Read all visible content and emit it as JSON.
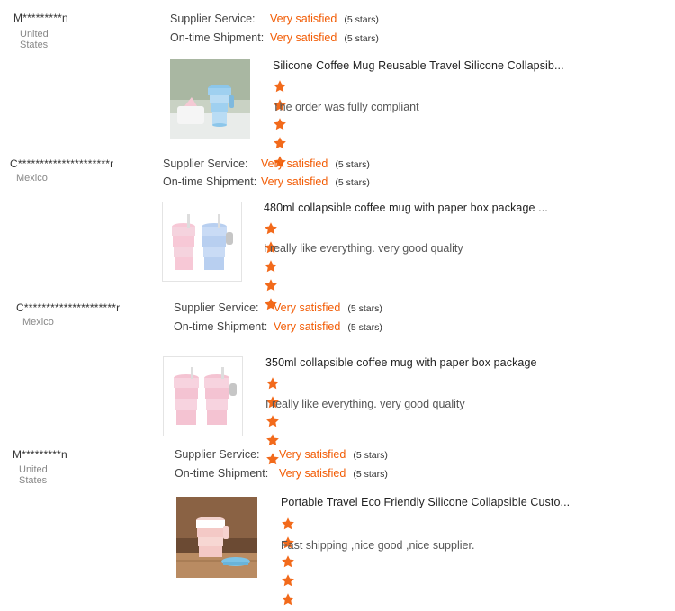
{
  "reviews": [
    {
      "buyer": "M*********n",
      "country": "United States",
      "supplier_label": "Supplier Service:",
      "supplier_value": "Very satisfied",
      "supplier_stars": "(5 stars)",
      "shipment_label": "On-time Shipment:",
      "shipment_value": "Very satisfied",
      "shipment_stars": "(5 stars)",
      "product_title": "Silicone Coffee Mug Reusable Travel Silicone Collapsib...",
      "rating": 5,
      "comment": "The order was fully compliant",
      "thumb_icon": "green-collapsible-mug-photo"
    },
    {
      "buyer": "C*********************r",
      "country": "Mexico",
      "supplier_label": "Supplier Service:",
      "supplier_value": "Very satisfied",
      "supplier_stars": "(5 stars)",
      "shipment_label": "On-time Shipment:",
      "shipment_value": "Very satisfied",
      "shipment_stars": "(5 stars)",
      "product_title": "480ml collapsible coffee mug with paper box package ...",
      "rating": 5,
      "comment": "I really like everything. very good quality",
      "thumb_icon": "pink-blue-mugs-photo"
    },
    {
      "buyer": "C*********************r",
      "country": "Mexico",
      "supplier_label": "Supplier Service:",
      "supplier_value": "Very satisfied",
      "supplier_stars": "(5 stars)",
      "shipment_label": "On-time Shipment:",
      "shipment_value": "Very satisfied",
      "shipment_stars": "(5 stars)",
      "product_title": "350ml collapsible coffee mug with paper box package",
      "rating": 5,
      "comment": "I really like everything. very good quality",
      "thumb_icon": "pink-mugs-photo"
    },
    {
      "buyer": "M*********n",
      "country": "United States",
      "supplier_label": "Supplier Service:",
      "supplier_value": "Very satisfied",
      "supplier_stars": "(5 stars)",
      "shipment_label": "On-time Shipment:",
      "shipment_value": "Very satisfied",
      "shipment_stars": "(5 stars)",
      "product_title": "Portable Travel Eco Friendly Silicone Collapsible Custo...",
      "rating": 5,
      "comment": "Fast shipping ,nice good ,nice supplier.",
      "thumb_icon": "pink-mug-wood-table-photo"
    }
  ],
  "colors": {
    "accent": "#f25c05",
    "star": "#f26a1b",
    "text": "#333333",
    "muted": "#888888"
  }
}
